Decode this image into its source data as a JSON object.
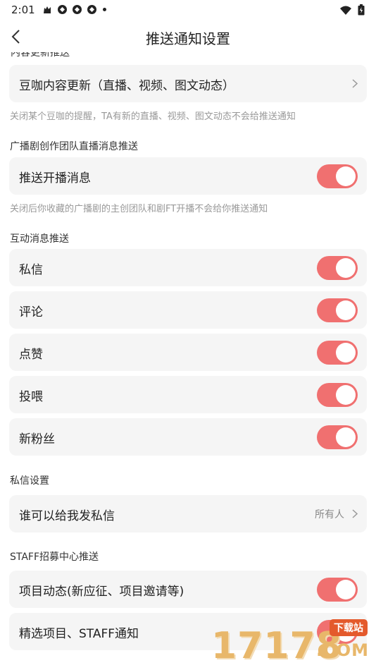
{
  "status_bar": {
    "time": "2:01",
    "left_icons": [
      "cat-icon",
      "app-icon",
      "app-icon",
      "app-icon",
      "dot-icon"
    ],
    "right_icons": [
      "wifi-icon",
      "battery-icon"
    ]
  },
  "nav": {
    "title": "推送通知设置"
  },
  "sections": {
    "clipped_header": "内容更新推送",
    "douka_update": {
      "label": "豆咖内容更新（直播、视频、图文动态）",
      "hint": "关闭某个豆咖的提醒，TA有新的直播、视频、图文动态不会给推送通知"
    },
    "live_section": {
      "title": "广播剧创作团队直播消息推送",
      "item_label": "推送开播消息",
      "item_on": true,
      "hint": "关闭后你收藏的广播剧的主创团队和剧FT开播不会给你推送通知"
    },
    "interaction": {
      "title": "互动消息推送",
      "items": [
        {
          "label": "私信",
          "on": true
        },
        {
          "label": "评论",
          "on": true
        },
        {
          "label": "点赞",
          "on": true
        },
        {
          "label": "投喂",
          "on": true
        },
        {
          "label": "新粉丝",
          "on": true
        }
      ]
    },
    "dm_settings": {
      "title": "私信设置",
      "item_label": "谁可以给我发私信",
      "item_value": "所有人"
    },
    "staff": {
      "title": "STAFF招募中心推送",
      "items": [
        {
          "label": "项目动态(新应征、项目邀请等)",
          "on": true
        },
        {
          "label": "精选项目、STAFF通知",
          "on": true
        }
      ]
    }
  },
  "watermark": {
    "digits": "17178",
    "badge": "下载站",
    "com": ".COM"
  },
  "colors": {
    "accent": "#f07070",
    "card_bg": "#f5f5f5",
    "hint": "#999999"
  }
}
